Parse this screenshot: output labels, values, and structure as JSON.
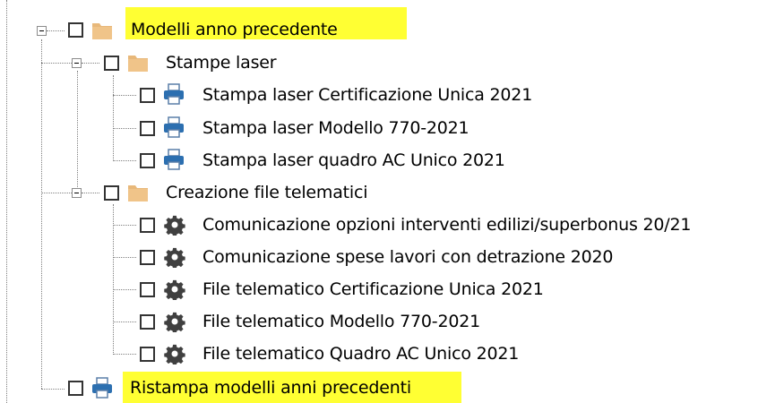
{
  "colors": {
    "highlight": "#ffff33",
    "folder": "#e8b87a",
    "printer": "#2c6fb0",
    "gear": "#404040"
  },
  "tree": {
    "root": {
      "label": "Modelli anno precedente",
      "icon": "folder-icon",
      "highlighted": true,
      "expanded": true
    },
    "group_laser": {
      "label": "Stampe laser",
      "icon": "folder-icon",
      "expanded": true,
      "items": [
        {
          "label": "Stampa laser Certificazione Unica 2021",
          "icon": "printer-icon"
        },
        {
          "label": "Stampa laser Modello 770-2021",
          "icon": "printer-icon"
        },
        {
          "label": "Stampa laser quadro AC Unico 2021",
          "icon": "printer-icon"
        }
      ]
    },
    "group_telematici": {
      "label": "Creazione file telematici",
      "icon": "folder-icon",
      "expanded": true,
      "items": [
        {
          "label": "Comunicazione opzioni interventi edilizi/superbonus 20/21",
          "icon": "gear-icon"
        },
        {
          "label": "Comunicazione spese lavori con detrazione 2020",
          "icon": "gear-icon"
        },
        {
          "label": "File telematico Certificazione Unica 2021",
          "icon": "gear-icon"
        },
        {
          "label": "File telematico Modello 770-2021",
          "icon": "gear-icon"
        },
        {
          "label": "File telematico Quadro AC Unico 2021",
          "icon": "gear-icon"
        }
      ]
    },
    "last_item": {
      "label": "Ristampa modelli anni precedenti",
      "icon": "printer-icon",
      "highlighted": true
    }
  }
}
